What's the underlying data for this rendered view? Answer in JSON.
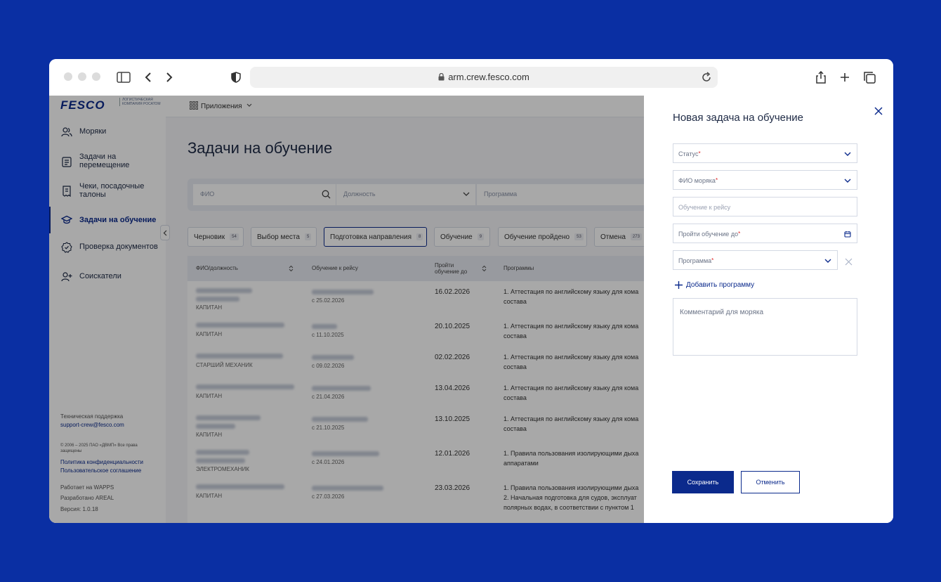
{
  "browser": {
    "url": "arm.crew.fesco.com"
  },
  "sidebar": {
    "logo": "FESCO",
    "logo_sub": "ЛОГИСТИЧЕСКАЯ КОМПАНИЯ РОСАТОМ",
    "items": [
      {
        "label": "Моряки",
        "icon": "people-icon"
      },
      {
        "label": "Задачи на перемещение",
        "icon": "task-icon"
      },
      {
        "label": "Чеки, посадочные талоны",
        "icon": "receipt-icon"
      },
      {
        "label": "Задачи на обучение",
        "icon": "graduation-cap-icon",
        "active": true
      },
      {
        "label": "Проверка документов",
        "icon": "check-badge-icon"
      },
      {
        "label": "Соискатели",
        "icon": "user-plus-icon"
      }
    ],
    "support_title": "Техническая поддержка",
    "support_email": "support-crew@fesco.com",
    "copyright": "© 2006 – 2025 ПАО «ДВМП» Все права защищены",
    "privacy": "Политика конфиденциальности",
    "agreement": "Пользовательское соглашение",
    "powered": "Работает на WAPPS",
    "developed": "Разработано AREAL",
    "version": "Версия: 1.0.18"
  },
  "topbar": {
    "apps": "Приложения"
  },
  "main": {
    "title": "Задачи на обучение",
    "filters": {
      "fio": "ФИО",
      "position": "Должность",
      "program": "Программа"
    },
    "tabs": [
      {
        "label": "Черновик",
        "count": "54"
      },
      {
        "label": "Выбор места",
        "count": "5"
      },
      {
        "label": "Подготовка направления",
        "count": "8",
        "active": true
      },
      {
        "label": "Обучение",
        "count": "9"
      },
      {
        "label": "Обучение пройдено",
        "count": "53"
      },
      {
        "label": "Отмена",
        "count": "273"
      }
    ],
    "columns": {
      "fio": "ФИО/должность",
      "voyage": "Обучение к рейсу",
      "deadline": "Пройти обучение до",
      "programs": "Программы"
    },
    "rows": [
      {
        "position": "КАПИТАН",
        "voyage_date": "с 25.02.2026",
        "deadline": "16.02.2026",
        "programs": [
          "1. Аттестация по английскому языку для кома",
          "состава"
        ]
      },
      {
        "position": "КАПИТАН",
        "voyage_date": "с 11.10.2025",
        "deadline": "20.10.2025",
        "programs": [
          "1. Аттестация по английскому языку для кома",
          "состава"
        ]
      },
      {
        "position": "СТАРШИЙ МЕХАНИК",
        "voyage_date": "с 09.02.2026",
        "deadline": "02.02.2026",
        "programs": [
          "1. Аттестация по английскому языку для кома",
          "состава"
        ]
      },
      {
        "position": "КАПИТАН",
        "voyage_date": "с 21.04.2026",
        "deadline": "13.04.2026",
        "programs": [
          "1. Аттестация по английскому языку для кома",
          "состава"
        ]
      },
      {
        "position": "КАПИТАН",
        "voyage_date": "с 21.10.2025",
        "deadline": "13.10.2025",
        "programs": [
          "1. Аттестация по английскому языку для кома",
          "состава"
        ]
      },
      {
        "position": "ЭЛЕКТРОМЕХАНИК",
        "voyage_date": "с 24.01.2026",
        "deadline": "12.01.2026",
        "programs": [
          "1. Правила пользования изолирующими дыха",
          "аппаратами"
        ]
      },
      {
        "position": "КАПИТАН",
        "voyage_date": "с 27.03.2026",
        "deadline": "23.03.2026",
        "programs": [
          "1. Правила пользования изолирующими дыха",
          "2. Начальная подготовка для судов, эксплуат",
          "полярных водах, в соответствии с пунктом 1"
        ]
      }
    ]
  },
  "modal": {
    "title": "Новая задача на обучение",
    "status": "Статус",
    "seaman": "ФИО моряка",
    "voyage": "Обучение к рейсу",
    "deadline": "Пройти обучение до",
    "program": "Программа",
    "add_program": "Добавить программу",
    "comment": "Комментарий для моряка",
    "save": "Сохранить",
    "cancel": "Отменить",
    "accent": "#0b2a8c"
  }
}
